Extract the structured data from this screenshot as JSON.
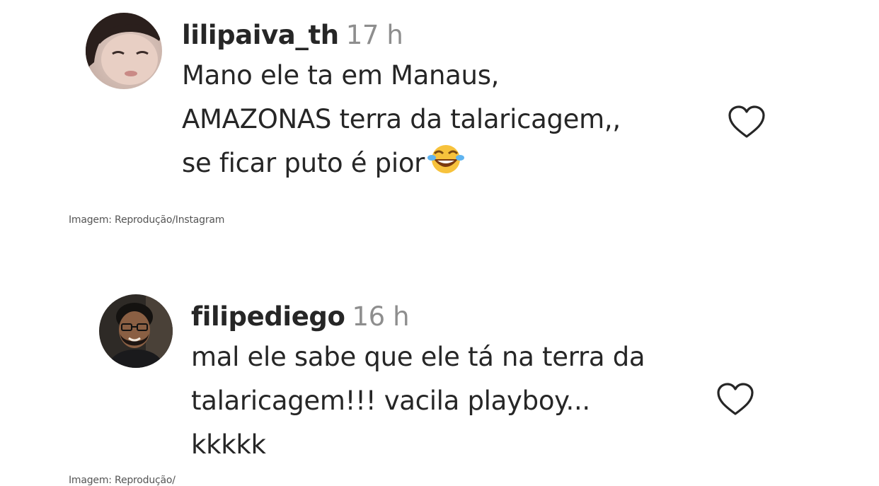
{
  "comments": [
    {
      "username": "lilipaiva_th",
      "time": "17 h",
      "lines": [
        "Mano ele ta em Manaus,",
        "AMAZONAS terra da talaricagem,,",
        "se ficar puto é pior"
      ],
      "emoji": "face-with-tears-of-joy",
      "like_icon": "heart-outline-icon"
    },
    {
      "username": "filipediego",
      "time": "16 h",
      "lines": [
        "mal ele sabe que ele tá na terra da",
        "talaricagem!!! vacila playboy...",
        "kkkkk"
      ],
      "like_icon": "heart-outline-icon"
    }
  ],
  "captions": [
    "Imagem: Reprodução/Instagram",
    "Imagem: Reprodução/"
  ],
  "colors": {
    "text": "#262626",
    "muted": "#8e8e8e",
    "caption": "#555555",
    "background": "#ffffff"
  }
}
